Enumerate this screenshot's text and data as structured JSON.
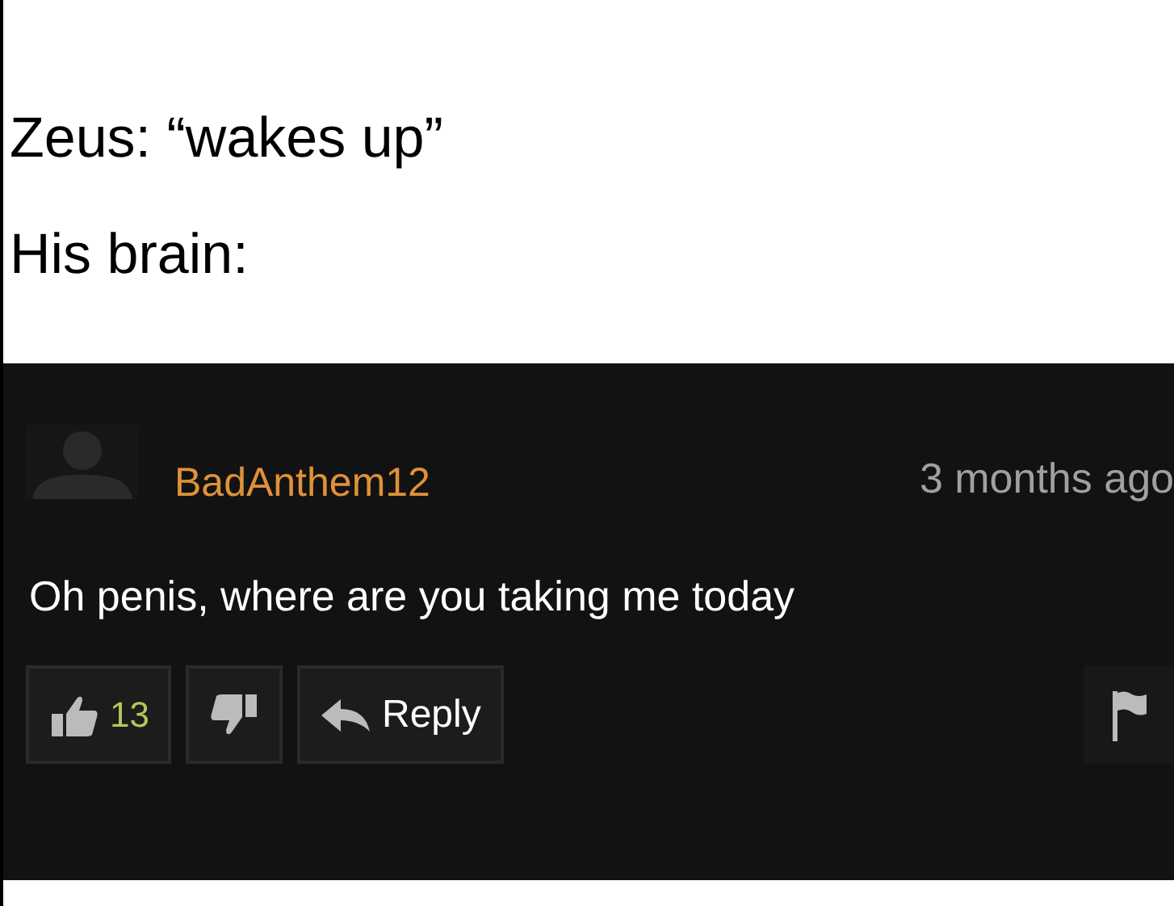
{
  "caption": [
    "Zeus: “wakes up”",
    "His brain:"
  ],
  "comment": {
    "username": "BadAnthem12",
    "time": "3 months ago",
    "text": "Oh penis, where are you taking me today",
    "likes": "13",
    "reply_label": "Reply"
  }
}
